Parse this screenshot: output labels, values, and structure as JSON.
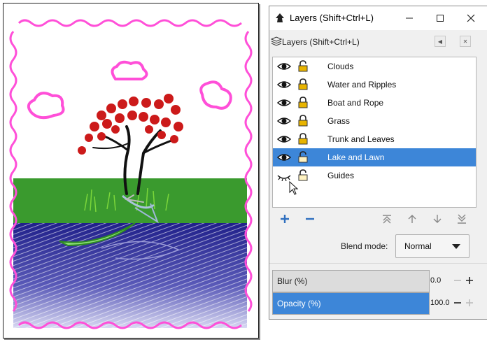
{
  "window": {
    "title": "Layers (Shift+Ctrl+L)",
    "dock_title": "Layers (Shift+Ctrl+L)"
  },
  "icons": {
    "app": "inkscape-icon",
    "minimize": "minimize-icon",
    "maximize": "maximize-icon",
    "close": "close-icon",
    "visible": "eye-icon",
    "hidden": "eye-closed-icon",
    "lock": "padlock-icon"
  },
  "layers": [
    {
      "name": "Clouds",
      "visible": true,
      "selected": false
    },
    {
      "name": "Water and Ripples",
      "visible": true,
      "selected": false
    },
    {
      "name": "Boat and Rope",
      "visible": true,
      "selected": false
    },
    {
      "name": "Grass",
      "visible": true,
      "selected": false
    },
    {
      "name": "Trunk and Leaves",
      "visible": true,
      "selected": false
    },
    {
      "name": "Lake and Lawn",
      "visible": true,
      "selected": true
    },
    {
      "name": "Guides",
      "visible": false,
      "selected": false
    }
  ],
  "blend": {
    "label": "Blend mode:",
    "value": "Normal"
  },
  "blur": {
    "label": "Blur (%)",
    "value": "0.0",
    "level": 0
  },
  "opacity": {
    "label": "Opacity (%)",
    "value": "100.0",
    "level": 100
  },
  "colors": {
    "selection": "#3d86d8",
    "border_pink": "#ff4fd8",
    "grass_green": "#3a9a2e",
    "water_blue": "#2a2a9a",
    "leaf_red": "#cc1a1a"
  }
}
